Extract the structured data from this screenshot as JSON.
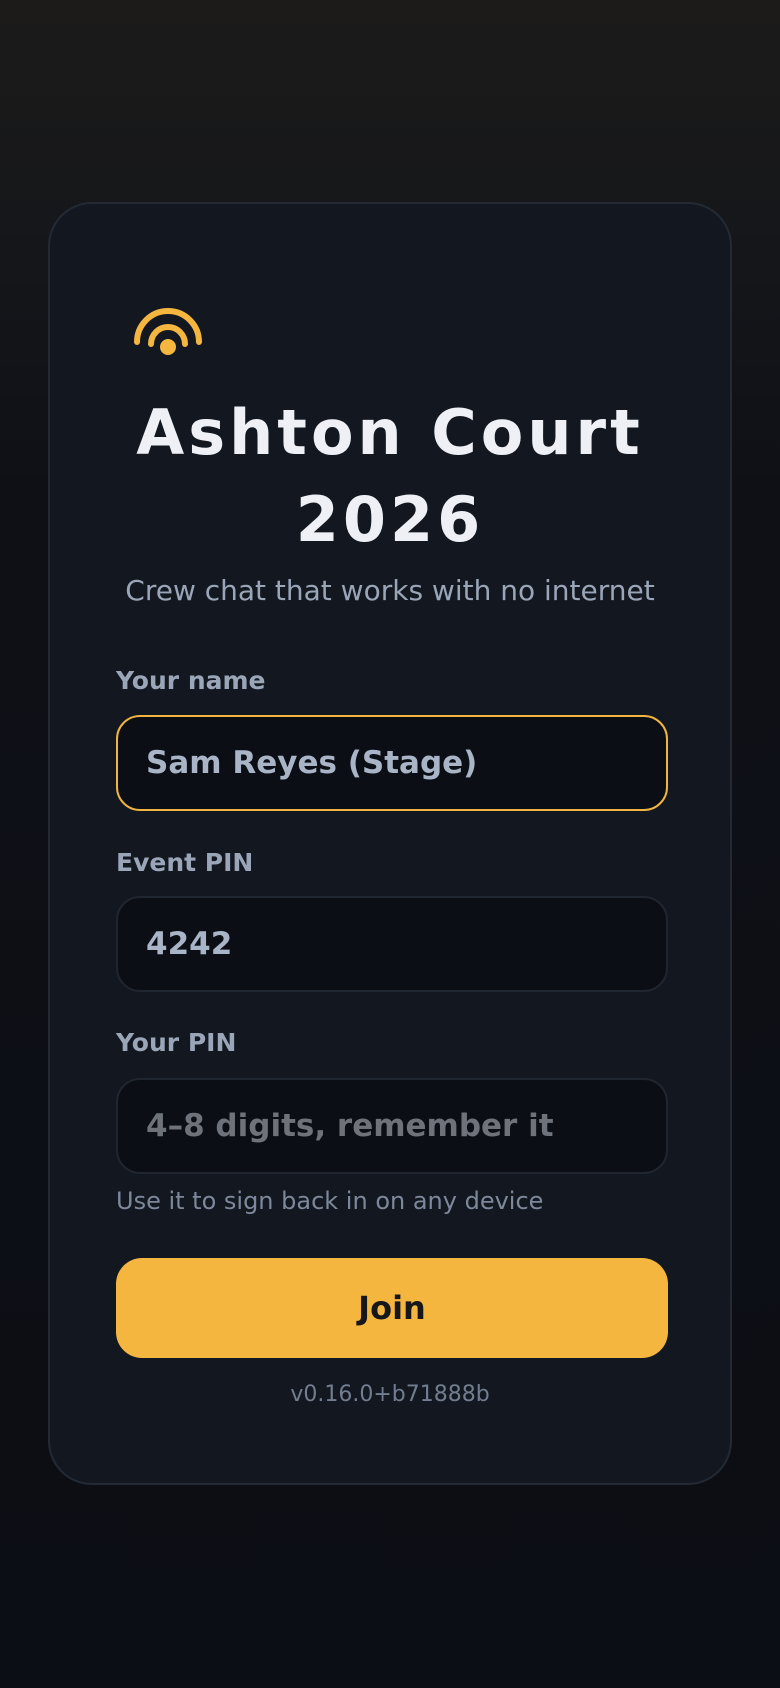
{
  "app": {
    "logo_icon": "wireless-signal-icon",
    "accent_color": "#f5b640",
    "title": "Ashton Court 2026",
    "subtitle": "Crew chat that works with no internet"
  },
  "form": {
    "name": {
      "label": "Your name",
      "value": "Sam Reyes (Stage)"
    },
    "event_pin": {
      "label": "Event PIN",
      "value": "4242"
    },
    "your_pin": {
      "label": "Your PIN",
      "value": "",
      "placeholder": "4–8 digits, remember it",
      "hint": "Use it to sign back in on any device"
    },
    "join_label": "Join"
  },
  "footer": {
    "version": "v0.16.0+b71888b"
  }
}
